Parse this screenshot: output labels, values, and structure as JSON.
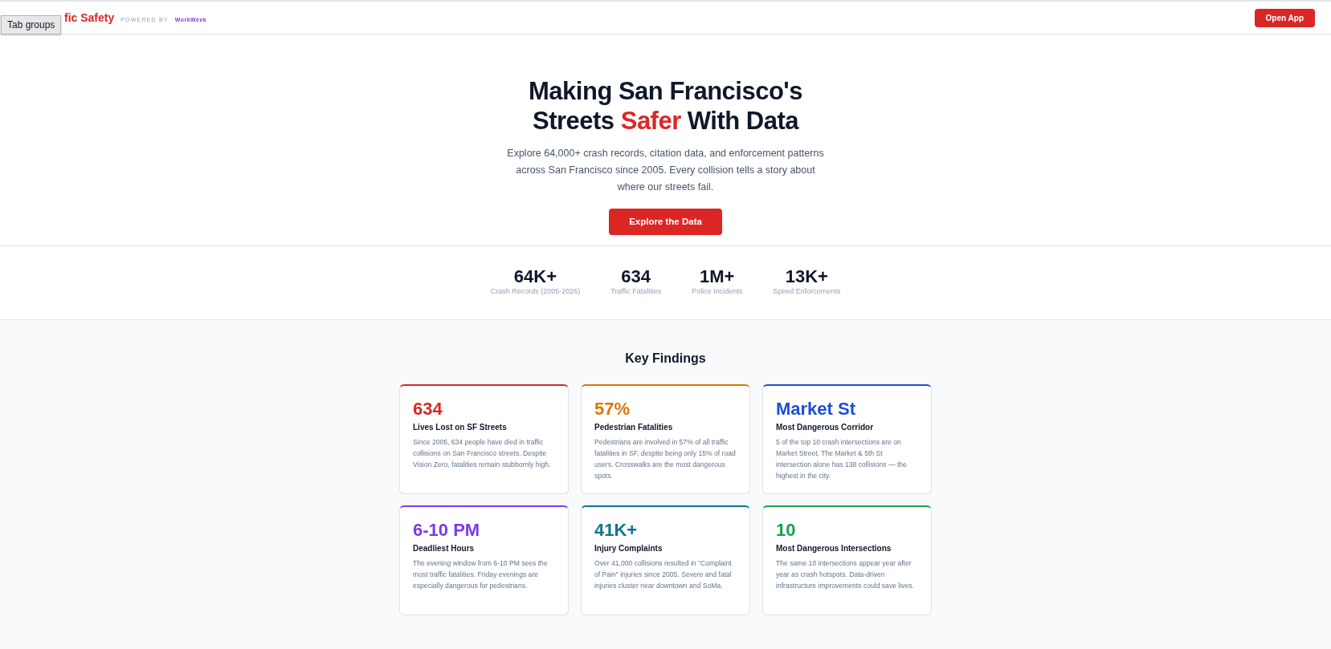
{
  "tooltip": "Tab groups",
  "header": {
    "logo": "fic Safety",
    "powered_by": "POWERED BY",
    "brand": "WorkWeek",
    "button": "Open App"
  },
  "hero": {
    "title_start": "Making San Francisco's Streets ",
    "title_accent": "Safer",
    "title_end": " With Data",
    "text": "Explore 64,000+ crash records, citation data, and enforcement patterns across San Francisco since 2005. Every collision tells a story about where our streets fail.",
    "button": "Explore the Data"
  },
  "stats": [
    {
      "value": "64K+",
      "label": "Crash Records (2005-2026)"
    },
    {
      "value": "634",
      "label": "Traffic Fatalities"
    },
    {
      "value": "1M+",
      "label": "Police Incidents"
    },
    {
      "value": "13K+",
      "label": "Speed Enforcements"
    }
  ],
  "findings": {
    "title": "Key Findings",
    "cards": [
      {
        "value": "634",
        "title": "Lives Lost on SF Streets",
        "text": "Since 2005, 634 people have died in traffic collisions on San Francisco streets. Despite Vision Zero, fatalities remain stubbornly high.",
        "color": "#dc2626"
      },
      {
        "value": "57%",
        "title": "Pedestrian Fatalities",
        "text": "Pedestrians are involved in 57% of all traffic fatalities in SF, despite being only 15% of road users. Crosswalks are the most dangerous spots.",
        "color": "#d97706"
      },
      {
        "value": "Market St",
        "title": "Most Dangerous Corridor",
        "text": "5 of the top 10 crash intersections are on Market Street. The Market & 5th St intersection alone has 138 collisions — the highest in the city.",
        "color": "#1d4ed8"
      },
      {
        "value": "6-10 PM",
        "title": "Deadliest Hours",
        "text": "The evening window from 6-10 PM sees the most traffic fatalities. Friday evenings are especially dangerous for pedestrians.",
        "color": "#7c3aed"
      },
      {
        "value": "41K+",
        "title": "Injury Complaints",
        "text": "Over 41,000 collisions resulted in \"Complaint of Pain\" injuries since 2005. Severe and fatal injuries cluster near downtown and SoMa.",
        "color": "#0e7490"
      },
      {
        "value": "10",
        "title": "Most Dangerous Intersections",
        "text": "The same 10 intersections appear year after year as crash hotspots. Data-driven infrastructure improvements could save lives.",
        "color": "#16a34a"
      }
    ]
  }
}
